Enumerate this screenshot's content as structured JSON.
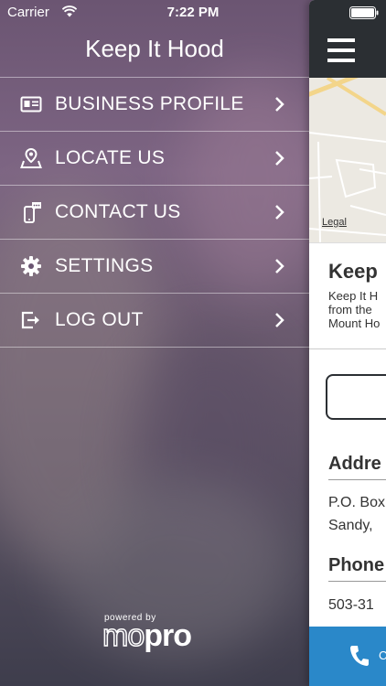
{
  "status_bar": {
    "carrier": "Carrier",
    "time": "7:22 PM",
    "wifi_icon": "wifi-icon",
    "battery_icon": "battery-icon"
  },
  "menu": {
    "title": "Keep It Hood",
    "items": [
      {
        "label": "BUSINESS PROFILE",
        "icon": "id-card-icon"
      },
      {
        "label": "LOCATE US",
        "icon": "map-pin-icon"
      },
      {
        "label": "CONTACT US",
        "icon": "phone-chat-icon"
      },
      {
        "label": "SETTINGS",
        "icon": "gear-icon"
      },
      {
        "label": "LOG OUT",
        "icon": "logout-icon"
      }
    ],
    "powered_by": "powered by",
    "logo_part1": "mo",
    "logo_part2": "pro"
  },
  "panel": {
    "map_legal": "Legal",
    "business_name": "Keep",
    "description_lines": [
      "Keep It H",
      "from the",
      "Mount Ho"
    ],
    "address_title": "Addre",
    "address_lines": [
      "P.O. Box",
      "Sandy,"
    ],
    "phone_title": "Phone",
    "phone_value": "503-31",
    "call_label": "C"
  },
  "colors": {
    "panel_header": "#2b2f33",
    "call_bar": "#2a88c9",
    "menu_text": "#ffffff"
  }
}
